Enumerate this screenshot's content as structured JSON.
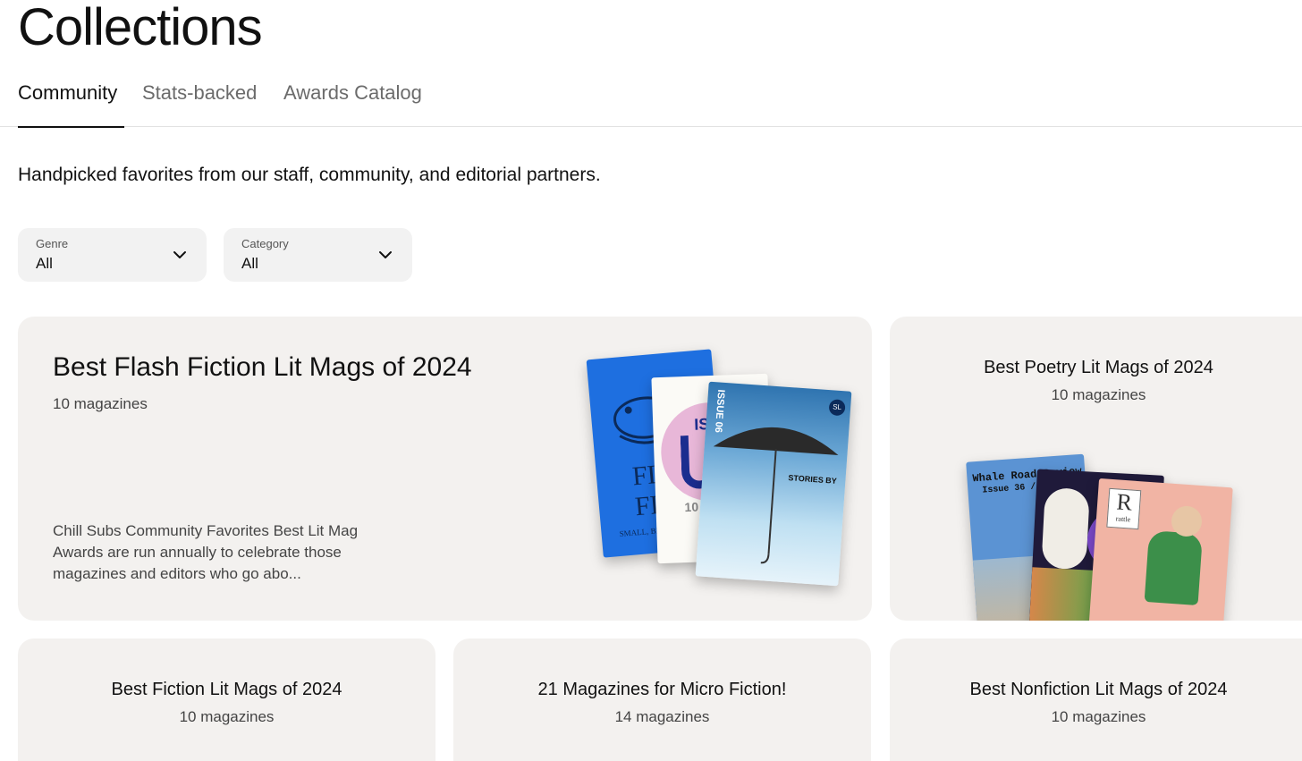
{
  "page": {
    "title": "Collections"
  },
  "tabs": [
    {
      "label": "Community",
      "active": true
    },
    {
      "label": "Stats-backed",
      "active": false
    },
    {
      "label": "Awards Catalog",
      "active": false
    }
  ],
  "subtitle": "Handpicked favorites from our staff, community, and editorial partners.",
  "filters": [
    {
      "label": "Genre",
      "value": "All",
      "icon": "chevron-down-icon"
    },
    {
      "label": "Category",
      "value": "All",
      "icon": "chevron-down-icon"
    }
  ],
  "featured": {
    "title": "Best Flash Fiction Lit Mags of 2024",
    "count": "10 magazines",
    "description": "Chill Subs Community Favorites Best Lit Mag Awards are run annually to celebrate those magazines and editors who go abo..."
  },
  "collections": [
    {
      "title": "Best Poetry Lit Mags of 2024",
      "count": "10 magazines"
    },
    {
      "title": "Best Fiction Lit Mags of 2024",
      "count": "10 magazines"
    },
    {
      "title": "21 Magazines for Micro Fiction!",
      "count": "14 magazines"
    },
    {
      "title": "Best Nonfiction Lit Mags of 2024",
      "count": "10 magazines"
    }
  ],
  "cover_text": {
    "flash1": "FL",
    "flash2": "FI",
    "flash_small": "SMALL, BE DEADL",
    "iss": "ISS",
    "num": "10",
    "issue06": "ISSUE 06",
    "stories": "STORIES BY",
    "whale": "Whale Road Review",
    "whale_issue": "Issue 36 / M",
    "rattle_r": "R",
    "rattle_name": "rattle",
    "sl": "SL"
  },
  "colors": {
    "card_bg": "#f3f1ef",
    "filter_bg": "#f2f2f2",
    "accent_blue": "#1e6fe0"
  }
}
